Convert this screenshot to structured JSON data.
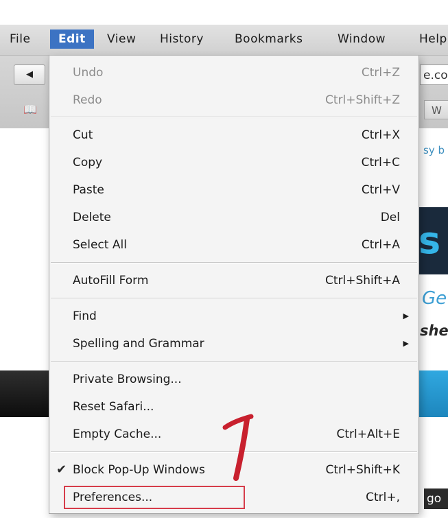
{
  "menubar": {
    "items": [
      "File",
      "Edit",
      "View",
      "History",
      "Bookmarks",
      "Window",
      "Help"
    ]
  },
  "toolbar": {
    "back_label": "◀",
    "bookmarks_icon": "📖",
    "address_fragment": "e.co",
    "bookmark_fragment": "W"
  },
  "page_fragments": {
    "link_fragment": "sy b",
    "banner_fragment": "s",
    "tagline_fragment": "Ge",
    "subtitle_fragment": "she",
    "footer_fragment": "go"
  },
  "edit_menu": {
    "undo": {
      "label": "Undo",
      "shortcut": "Ctrl+Z"
    },
    "redo": {
      "label": "Redo",
      "shortcut": "Ctrl+Shift+Z"
    },
    "cut": {
      "label": "Cut",
      "shortcut": "Ctrl+X"
    },
    "copy": {
      "label": "Copy",
      "shortcut": "Ctrl+C"
    },
    "paste": {
      "label": "Paste",
      "shortcut": "Ctrl+V"
    },
    "delete": {
      "label": "Delete",
      "shortcut": "Del"
    },
    "select_all": {
      "label": "Select All",
      "shortcut": "Ctrl+A"
    },
    "autofill": {
      "label": "AutoFill Form",
      "shortcut": "Ctrl+Shift+A"
    },
    "find": {
      "label": "Find",
      "submenu": "▶"
    },
    "spelling": {
      "label": "Spelling and Grammar",
      "submenu": "▶"
    },
    "private_browsing": {
      "label": "Private Browsing..."
    },
    "reset_safari": {
      "label": "Reset Safari..."
    },
    "empty_cache": {
      "label": "Empty Cache...",
      "shortcut": "Ctrl+Alt+E"
    },
    "block_popups": {
      "label": "Block Pop-Up Windows",
      "shortcut": "Ctrl+Shift+K",
      "check": "✔"
    },
    "preferences": {
      "label": "Preferences...",
      "shortcut": "Ctrl+,"
    }
  },
  "colors": {
    "active_menu": "#3c73c3",
    "highlight_box": "#d63c4a",
    "annotation": "#c8202e"
  }
}
